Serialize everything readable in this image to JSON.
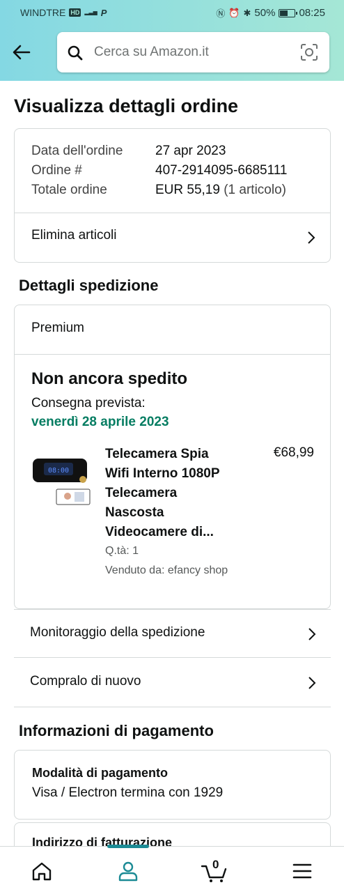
{
  "status_bar": {
    "carrier": "WINDTRE",
    "hd": "HD",
    "battery": "50%",
    "time": "08:25"
  },
  "search": {
    "placeholder": "Cerca su Amazon.it"
  },
  "page_title": "Visualizza dettagli ordine",
  "order_summary": {
    "date_label": "Data dell'ordine",
    "date_value": "27 apr 2023",
    "order_label": "Ordine #",
    "order_value": "407-2914095-6685111",
    "total_label": "Totale ordine",
    "total_value": "EUR 55,19",
    "total_items": "(1 articolo)",
    "delete_link": "Elimina articoli"
  },
  "shipping": {
    "section_title": "Dettagli spedizione",
    "service": "Premium",
    "status": "Non ancora spedito",
    "expected_label": "Consegna prevista:",
    "expected_date": "venerdì 28 aprile 2023",
    "product": {
      "title_lines": [
        "Telecamera Spia",
        "Wifi Interno 1080P",
        "Telecamera",
        "Nascosta",
        "Videocamere di..."
      ],
      "price": "€68,99",
      "quantity": "Q.tà: 1",
      "seller": "Venduto da: efancy shop"
    },
    "track_link": "Monitoraggio della spedizione",
    "buy_again_link": "Compralo di nuovo"
  },
  "payment": {
    "section_title": "Informazioni di pagamento",
    "method_title": "Modalità di pagamento",
    "method_value": "Visa / Electron  termina con 1929",
    "billing_title": "Indirizzo di fatturazione"
  },
  "bottom_nav": {
    "cart_count": "0"
  },
  "colors": {
    "header_gradient_start": "#84d8e3",
    "header_gradient_end": "#a5e7d6",
    "delivery_date_green": "#067d62",
    "nav_indicator": "#1c8b95"
  }
}
